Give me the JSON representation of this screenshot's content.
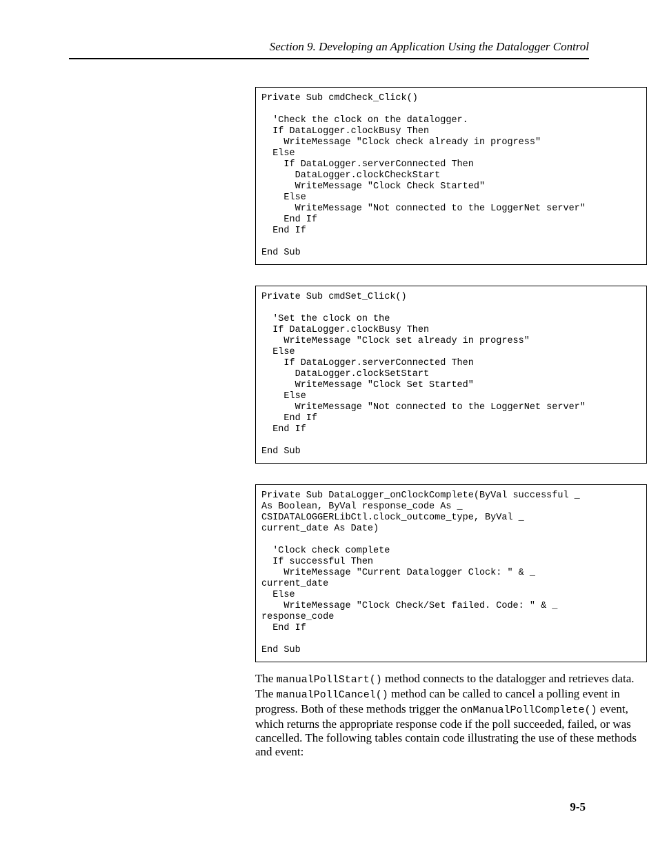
{
  "header": "Section 9.  Developing an Application Using the Datalogger Control",
  "code1": "Private Sub cmdCheck_Click()\n\n  'Check the clock on the datalogger.\n  If DataLogger.clockBusy Then\n    WriteMessage \"Clock check already in progress\"\n  Else\n    If DataLogger.serverConnected Then\n      DataLogger.clockCheckStart\n      WriteMessage \"Clock Check Started\"\n    Else\n      WriteMessage \"Not connected to the LoggerNet server\"\n    End If\n  End If\n\nEnd Sub",
  "code2": "Private Sub cmdSet_Click()\n\n  'Set the clock on the\n  If DataLogger.clockBusy Then\n    WriteMessage \"Clock set already in progress\"\n  Else\n    If DataLogger.serverConnected Then\n      DataLogger.clockSetStart\n      WriteMessage \"Clock Set Started\"\n    Else\n      WriteMessage \"Not connected to the LoggerNet server\"\n    End If\n  End If\n\nEnd Sub",
  "code3": "Private Sub DataLogger_onClockComplete(ByVal successful _\nAs Boolean, ByVal response_code As _\nCSIDATALOGGERLibCtl.clock_outcome_type, ByVal _\ncurrent_date As Date)\n\n  'Clock check complete\n  If successful Then\n    WriteMessage \"Current Datalogger Clock: \" & _\ncurrent_date\n  Else\n    WriteMessage \"Clock Check/Set failed. Code: \" & _\nresponse_code\n  End If\n\nEnd Sub",
  "para": {
    "t1": "The ",
    "m1": "manualPollStart()",
    "t2": " method connects to the datalogger and retrieves data.  The ",
    "m2": "manualPollCancel()",
    "t3": " method can be called to cancel a polling event in progress.  Both of these methods trigger the ",
    "m3": "onManualPollComplete()",
    "t4": " event, which returns the appropriate response code if the poll succeeded, failed, or was cancelled.  The following tables contain code illustrating the use of these methods and event:"
  },
  "page_number": "9-5"
}
